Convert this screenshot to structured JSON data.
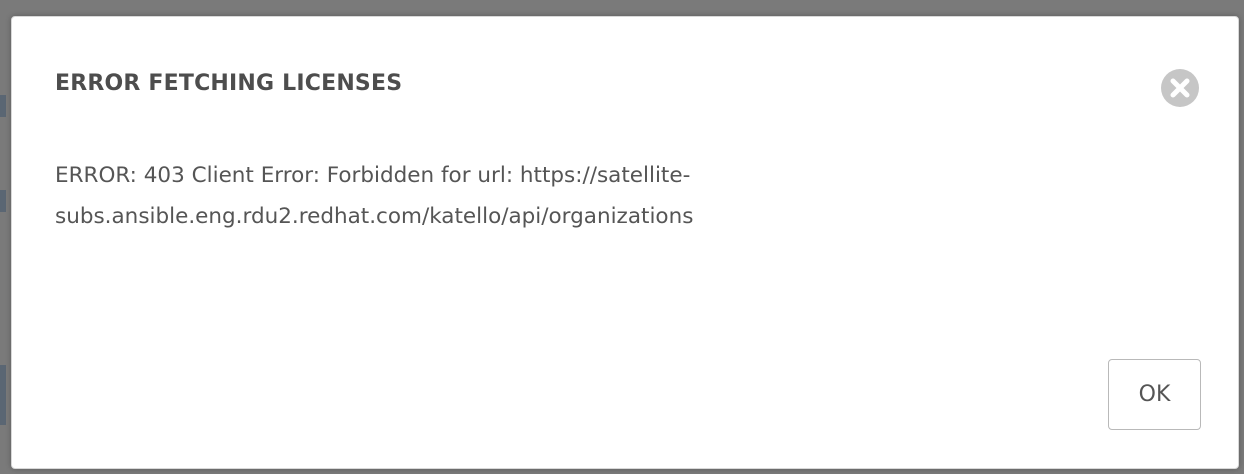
{
  "dialog": {
    "title": "ERROR FETCHING LICENSES",
    "message_line1": "ERROR: 403 Client Error: Forbidden for url: https://satellite-",
    "message_line2": "subs.ansible.eng.rdu2.redhat.com/katello/api/organizations",
    "ok_label": "OK",
    "close_icon": "close-circle-icon"
  },
  "colors": {
    "backdrop": "#7a7a7a",
    "modal_background": "#ffffff",
    "title_text": "#4d4d4d",
    "body_text": "#555555",
    "close_icon": "#c6c6c6",
    "button_border": "#b9b9b9"
  }
}
